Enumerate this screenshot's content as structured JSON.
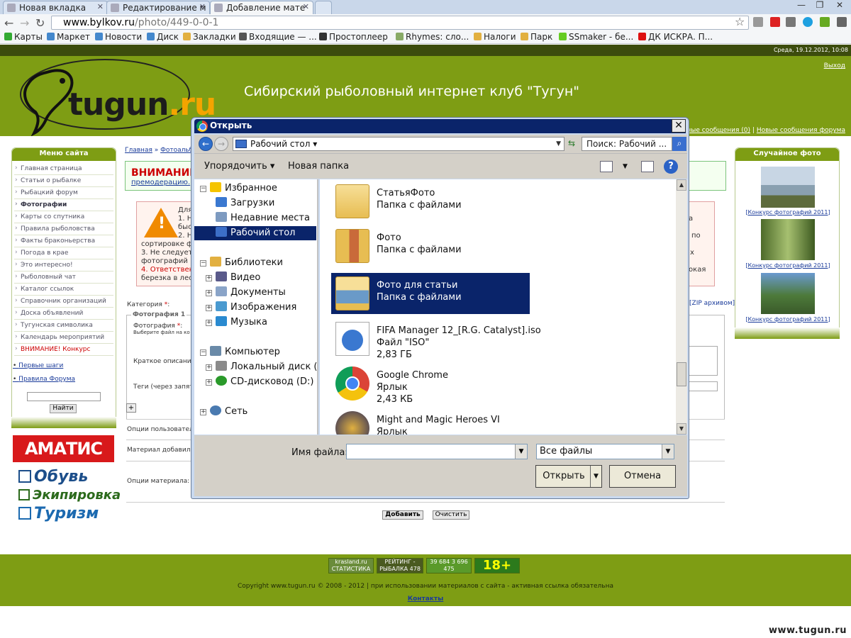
{
  "browser": {
    "tabs": [
      "Новая вкладка",
      "Редактирование м",
      "Добавление мате"
    ],
    "url_host": "www.bylkov.ru",
    "url_path": "/photo/449-0-0-1",
    "bookmarks": [
      "Карты",
      "Маркет",
      "Новости",
      "Диск",
      "Закладки",
      "Входящие — ...",
      "Простоплеер",
      "Rhymes: сло...",
      "Налоги",
      "Парк",
      "SSmaker - бе...",
      "ДК ИСКРА. П..."
    ],
    "window_controls": [
      "—",
      "❐",
      "✕"
    ]
  },
  "site": {
    "date": "Среда, 19.12.2012, 10:08",
    "logo_main": "tugun",
    "logo_tld": ".ru",
    "title": "Сибирский рыболовный интернет клуб \"Тугун\"",
    "logout": "Выход",
    "header_links": [
      "ичные сообщения (0)",
      "Новые сообщения форума"
    ],
    "header_sep": "|",
    "menu_title": "Меню сайта",
    "menu": [
      "Главная страница",
      "Статьи о рыбалке",
      "Рыбацкий форум",
      "Фотографии",
      "Карты со спутника",
      "Правила рыболовства",
      "Факты браконьерства",
      "Погода в крае",
      "Это интересно!",
      "Рыболовный чат",
      "Каталог ссылок",
      "Справочник организаций",
      "Доска объявлений",
      "Тугунская символика",
      "Календарь мероприятий",
      "ВНИМАНИЕ! Конкурс"
    ],
    "side_links": [
      "Первые шаги",
      "Правила Форума"
    ],
    "search_btn": "Найти",
    "ads": {
      "amatis": "АМАТИС",
      "lines": [
        "Обувь",
        "Экипировка",
        "Туризм"
      ]
    },
    "random_photo_title": "Случайное фото",
    "photo_captions": [
      "Конкурс фотографий 2011",
      "Конкурс фотографий 2011",
      "Конкурс фотографий 2011"
    ],
    "breadcrumb": [
      "Главная",
      "Фотоальбо"
    ],
    "warning_title": "ВНИМАНИЕ",
    "warning_link": "премодерацию.",
    "info_lines": [
      "Для",
      "1. Н",
      "быс",
      "2. Н",
      "сортировке ф",
      "3. Не следует",
      "фотографий '",
      "4. Ответствен",
      "березка в лес"
    ],
    "info_right": [
      "ка",
      "по",
      "х",
      "кокая"
    ],
    "info_red_line": "4. Ответствен",
    "form": {
      "category": "Категория",
      "legend": "Фотография 1",
      "photo_label": "Фотография",
      "photo_hint": "Выберите файл на ко",
      "short_desc": "Краткое описание",
      "tags": "Теги (через запяту",
      "user_opts": "Опции пользовател",
      "added_by": "Материал добавил:",
      "material_opts": "Опции материала:",
      "zip": "IP архивом]",
      "plus": "+",
      "add_btn": "Добавить",
      "clear_btn": "Очистить"
    },
    "counters": [
      "krasland.ru СТАТИСТИКА",
      "РЕЙТИНГ - РЫБАЛКА 478 2057",
      "39 684 3 696 475",
      "18+"
    ],
    "copyright": "Copyright www.tugun.ru © 2008 - 2012 | при использовании материалов с сайта - активная ссылка обязательна",
    "contacts": "Контакты",
    "watermark": "www.tugun.ru"
  },
  "dialog": {
    "title": "Открыть",
    "close": "✕",
    "path": "Рабочий стол",
    "search_placeholder": "Поиск: Рабочий ...",
    "organize": "Упорядочить",
    "new_folder": "Новая папка",
    "help": "?",
    "nav": [
      {
        "label": "Избранное",
        "color": "#f5c400"
      },
      {
        "label": "Загрузки",
        "color": "#3a78d0"
      },
      {
        "label": "Недавние места",
        "color": "#7d9ac0"
      },
      {
        "label": "Рабочий стол",
        "color": "#3c6fc8"
      },
      {
        "label": "Библиотеки",
        "color": "#e2b040"
      },
      {
        "label": "Видео",
        "color": "#5a5a8a"
      },
      {
        "label": "Документы",
        "color": "#8aa4c8"
      },
      {
        "label": "Изображения",
        "color": "#4a9ad0"
      },
      {
        "label": "Музыка",
        "color": "#2a8ad0"
      },
      {
        "label": "Компьютер",
        "color": "#6a8aa8"
      },
      {
        "label": "Локальный диск (C:)",
        "color": "#8a8a8a"
      },
      {
        "label": "CD-дисковод (D:) Ме",
        "color": "#2a9a2a"
      },
      {
        "label": "Сеть",
        "color": "#4a7ab0"
      }
    ],
    "files": [
      {
        "name": "СтатьяФото",
        "type": "Папка с файлами",
        "size": ""
      },
      {
        "name": "Фото",
        "type": "Папка с файлами",
        "size": ""
      },
      {
        "name": "Фото для статьи",
        "type": "Папка с файлами",
        "size": ""
      },
      {
        "name": "FIFA Manager 12_[R.G. Catalyst].iso",
        "type": "Файл \"ISO\"",
        "size": "2,83 ГБ"
      },
      {
        "name": "Google Chrome",
        "type": "Ярлык",
        "size": "2,43 КБ"
      },
      {
        "name": "Might and Magic Heroes VI",
        "type": "Ярлык",
        "size": ""
      }
    ],
    "filename_label": "Имя файла:",
    "filename_value": "",
    "filter": "Все файлы",
    "open_btn": "Открыть",
    "cancel_btn": "Отмена"
  },
  "colors": {
    "site_green": "#7e9d14",
    "dialog_blue": "#0a246a",
    "warning_red": "#c00000"
  }
}
